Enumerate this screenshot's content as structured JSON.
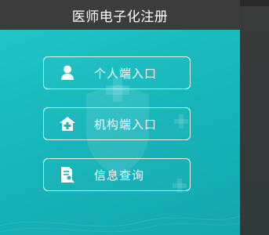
{
  "window": {
    "title": "医师电子化注册"
  },
  "buttons": [
    {
      "label": "个人端入口",
      "icon": "person-icon"
    },
    {
      "label": "机构端入口",
      "icon": "medical-house-icon"
    },
    {
      "label": "信息查询",
      "icon": "document-search-icon"
    }
  ],
  "colors": {
    "titlebar": "#3c3c3c",
    "content_bg": "#1ab9be",
    "button_border": "#ffffff",
    "text": "#ffffff"
  }
}
